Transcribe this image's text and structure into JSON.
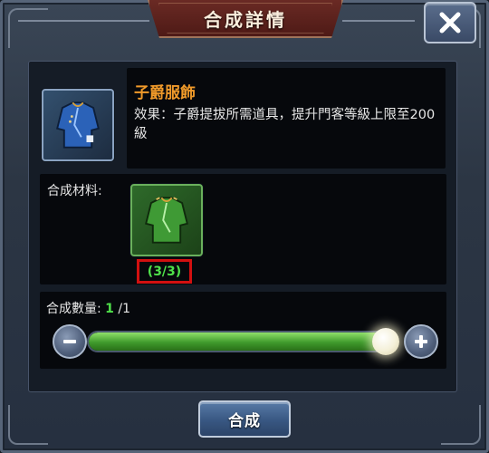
{
  "dialog": {
    "title": "合成詳情",
    "close_icon": "close-x-icon"
  },
  "item": {
    "icon": "blue-robe-icon",
    "name": "子爵服飾",
    "description": "效果：子爵提拔所需道具，提升門客等級上限至200級"
  },
  "materials": {
    "label": "合成材料:",
    "items": [
      {
        "icon": "green-robe-icon",
        "count_text": "(3/3)"
      }
    ]
  },
  "quantity": {
    "label": "合成數量:",
    "current": "1",
    "total": "/1",
    "slider_fraction": 1.0,
    "minus_icon": "minus-icon",
    "plus_icon": "plus-icon"
  },
  "actions": {
    "combine_label": "合成"
  },
  "colors": {
    "accent_orange": "#f09a2a",
    "ok_green": "#4fe04a",
    "highlight_red": "#d21010",
    "title_plate": "#5a201b"
  }
}
